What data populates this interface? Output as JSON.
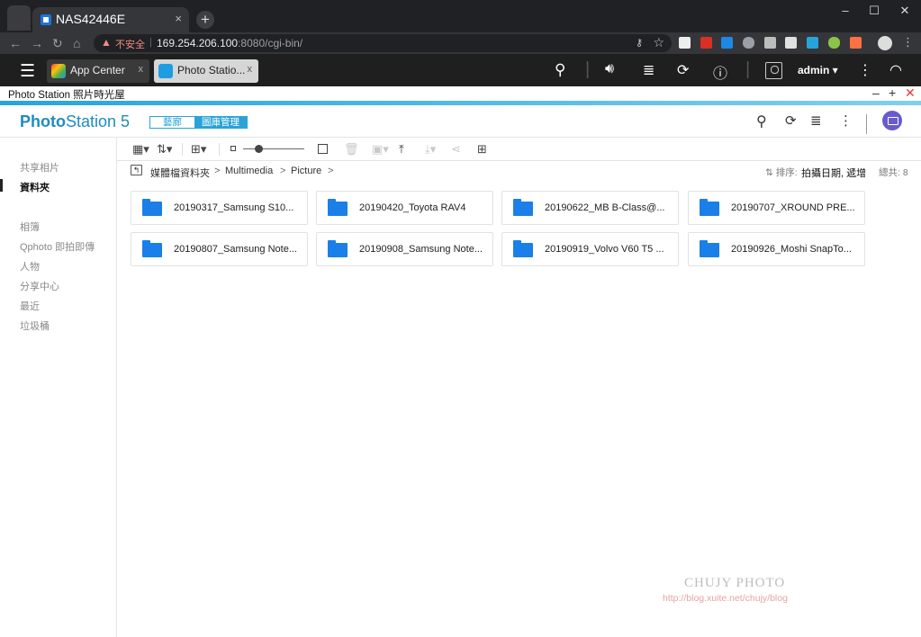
{
  "browser": {
    "tab_title": "NAS42446E",
    "tab_close": "×",
    "new_tab": "+",
    "window_controls": [
      "–",
      "☐",
      "✕"
    ],
    "security_label": "不安全",
    "url_host": "169.254.206.100",
    "url_rest": ":8080/cgi-bin/"
  },
  "qts": {
    "tabs": [
      {
        "label": "App Center",
        "close": "x"
      },
      {
        "label": "Photo Statio...",
        "close": "x"
      }
    ],
    "username": "admin ▾"
  },
  "window": {
    "title": "Photo Station 照片時光屋",
    "controls": [
      "–",
      "+",
      "✕"
    ]
  },
  "photostation": {
    "logo_bold": "Photo",
    "logo_rest": "Station 5",
    "mode_tabs": [
      "藝廊",
      "圖庫管理"
    ]
  },
  "sidebar": {
    "items": [
      "共享相片",
      "資料夾",
      "相簿",
      "Qphoto 即拍即傳",
      "人物",
      "分享中心",
      "最近",
      "垃圾桶"
    ],
    "active_index": 1
  },
  "breadcrumb": {
    "items": [
      "媒體檔資料夾",
      "Multimedia",
      "Picture"
    ],
    "separator": ">"
  },
  "sort": {
    "label": "排序:",
    "value": "拍攝日期, 遞增",
    "total": "總共: 8"
  },
  "folders": [
    "20190317_Samsung S10...",
    "20190420_Toyota RAV4",
    "20190622_MB B-Class@...",
    "20190707_XROUND PRE...",
    "20190807_Samsung Note...",
    "20190908_Samsung Note...",
    "20190919_Volvo V60 T5 ...",
    "20190926_Moshi SnapTo..."
  ],
  "watermark": {
    "title": "CHUJY PHOTO",
    "url": "http://blog.xuite.net/chujy/blog"
  },
  "colors": {
    "accent": "#29a3d8",
    "folder": "#1a7fe8",
    "topbar": "#1f1f1f"
  }
}
